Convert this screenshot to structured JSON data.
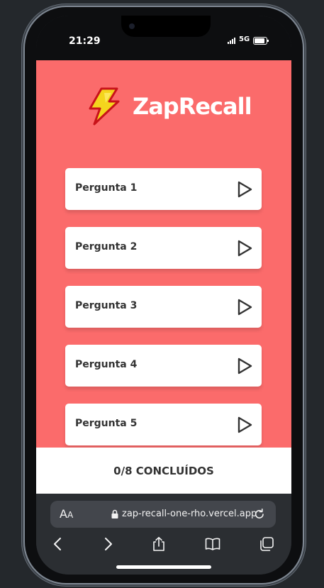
{
  "status": {
    "time": "21:29",
    "network": "5G"
  },
  "app": {
    "brand": "ZapRecall",
    "logo_icon": "lightning-icon",
    "accent_color": "#fb6b6b",
    "cards": [
      {
        "label": "Pergunta 1"
      },
      {
        "label": "Pergunta 2"
      },
      {
        "label": "Pergunta 3"
      },
      {
        "label": "Pergunta 4"
      },
      {
        "label": "Pergunta 5"
      }
    ],
    "footer": {
      "progress_text": "0/8 CONCLUÍDOS"
    }
  },
  "browser": {
    "aa_big": "A",
    "aa_small": "A",
    "url": "zap-recall-one-rho.vercel.app"
  }
}
